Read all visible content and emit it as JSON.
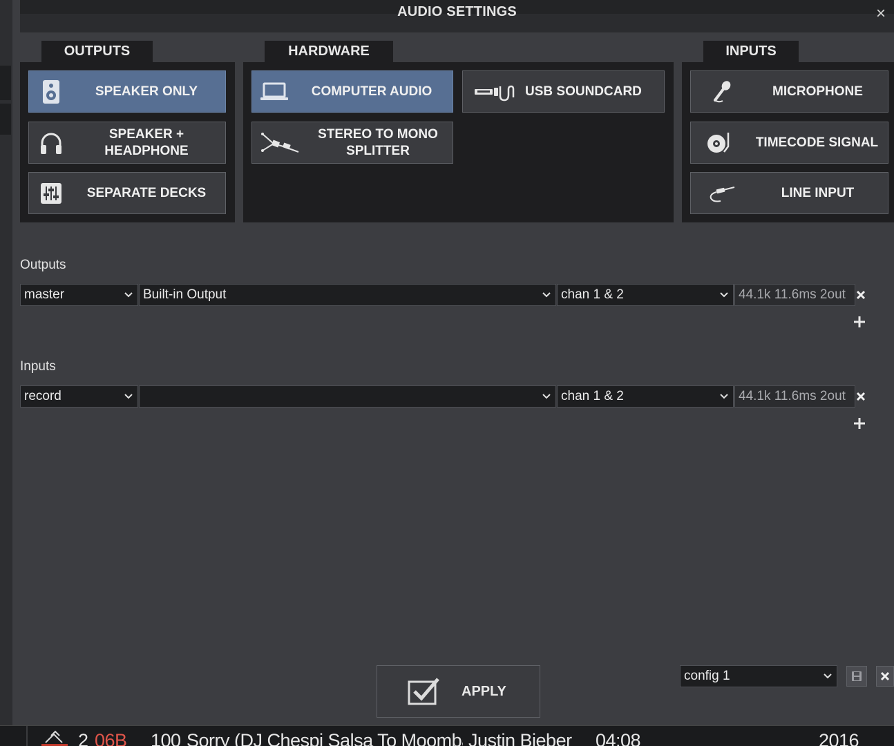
{
  "dialog": {
    "title": "AUDIO SETTINGS",
    "close_glyph": "×"
  },
  "tabs": {
    "outputs": "OUTPUTS",
    "hardware": "HARDWARE",
    "inputs": "INPUTS"
  },
  "outputs_buttons": [
    {
      "label": "SPEAKER ONLY",
      "icon": "speaker-icon",
      "active": true
    },
    {
      "label": "SPEAKER + HEADPHONE",
      "icon": "headphone-icon",
      "active": false
    },
    {
      "label": "SEPARATE DECKS",
      "icon": "mixer-icon",
      "active": false
    }
  ],
  "hardware_buttons": [
    {
      "label": "COMPUTER AUDIO",
      "icon": "laptop-icon",
      "active": true
    },
    {
      "label": "USB SOUNDCARD",
      "icon": "usb-icon",
      "active": false
    },
    {
      "label": "STEREO TO MONO SPLITTER",
      "icon": "splitter-cable-icon",
      "active": false
    }
  ],
  "inputs_buttons": [
    {
      "label": "MICROPHONE",
      "icon": "microphone-icon",
      "active": false
    },
    {
      "label": "TIMECODE SIGNAL",
      "icon": "turntable-icon",
      "active": false
    },
    {
      "label": "LINE INPUT",
      "icon": "line-cable-icon",
      "active": false
    }
  ],
  "outputs_section": {
    "label": "Outputs",
    "row": {
      "type": "master",
      "device": "Built-in Output",
      "channels": "chan 1 & 2",
      "info": "44.1k 11.6ms 2out"
    }
  },
  "inputs_section": {
    "label": "Inputs",
    "row": {
      "type": "record",
      "device": "",
      "channels": "chan 1 & 2",
      "info": "44.1k 11.6ms 2out"
    }
  },
  "footer": {
    "apply_label": "APPLY",
    "config_value": "config 1"
  },
  "bottom_bar": {
    "deck_number": "2",
    "key": "06B",
    "bpm": "100",
    "track_title": "Sorry (DJ Chespi Salsa To Moombahton - Cl",
    "artist": "Justin Bieber",
    "duration": "04:08",
    "year": "2016"
  },
  "colors": {
    "active_button": "#576f93",
    "panel": "#1e1e20",
    "background": "#3c3d41",
    "key_red": "#e0554a"
  }
}
